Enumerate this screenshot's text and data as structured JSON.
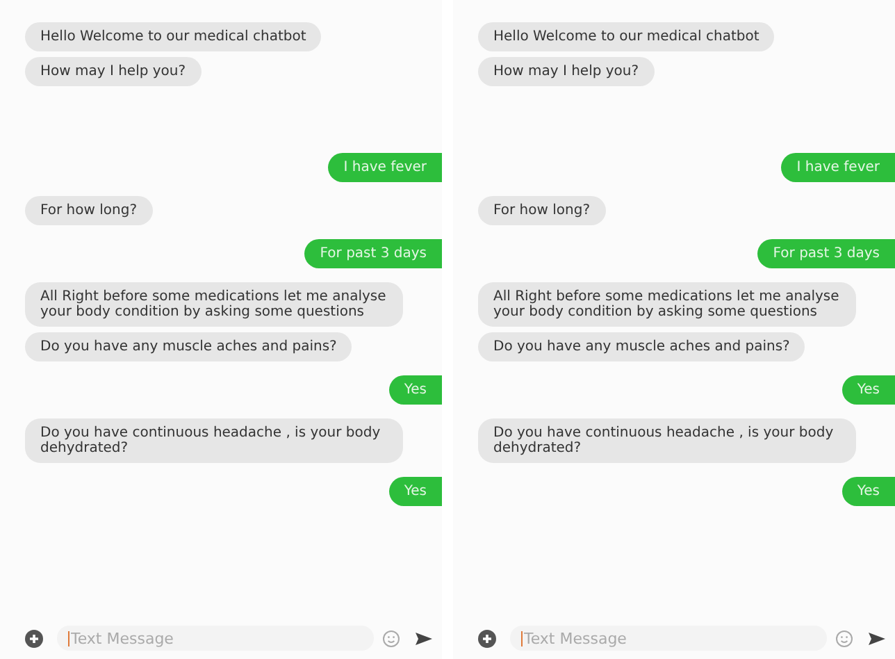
{
  "screens": [
    {
      "messages": [
        {
          "kind": "bot",
          "text": "Hello Welcome to our medical chatbot"
        },
        {
          "kind": "bot",
          "text": "How may I help you?"
        },
        {
          "kind": "user",
          "text": "I have fever"
        },
        {
          "kind": "bot",
          "text": "For how long?"
        },
        {
          "kind": "user",
          "text": "For past 3 days"
        },
        {
          "kind": "bot",
          "text": "All Right before some medications let me analyse your body condition by asking some questions"
        },
        {
          "kind": "bot",
          "text": "Do you have any muscle aches and pains?"
        },
        {
          "kind": "user",
          "text": "Yes"
        },
        {
          "kind": "bot",
          "text": "Do you have continuous headache , is your body dehydrated?"
        },
        {
          "kind": "user",
          "text": "Yes"
        }
      ],
      "composer": {
        "placeholder": "Text Message"
      }
    },
    {
      "messages": [
        {
          "kind": "bot",
          "text": "Hello Welcome to our medical chatbot"
        },
        {
          "kind": "bot",
          "text": "How may I help you?"
        },
        {
          "kind": "user",
          "text": "I have fever"
        },
        {
          "kind": "bot",
          "text": "For how long?"
        },
        {
          "kind": "user",
          "text": "For past 3 days"
        },
        {
          "kind": "bot",
          "text": "All Right before some medications let me analyse your body condition by asking some questions"
        },
        {
          "kind": "bot",
          "text": "Do you have any muscle aches and pains?"
        },
        {
          "kind": "user",
          "text": "Yes"
        },
        {
          "kind": "bot",
          "text": "Do you have continuous headache , is your body dehydrated?"
        },
        {
          "kind": "user",
          "text": "Yes"
        }
      ],
      "composer": {
        "placeholder": "Text Message"
      }
    }
  ]
}
